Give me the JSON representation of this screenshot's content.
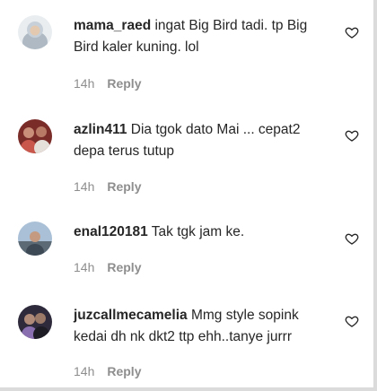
{
  "comments": [
    {
      "username": "mama_raed",
      "text": "ingat Big Bird tadi. tp Big Bird kaler kuning. lol",
      "time": "14h",
      "reply_label": "Reply",
      "avatar_icon": "user-avatar-hijab",
      "avatar_colors": [
        "#e8ecef",
        "#b9c3cc"
      ]
    },
    {
      "username": "azlin411",
      "text": "Dia tgok dato Mai ... cepat2 depa terus tutup",
      "time": "14h",
      "reply_label": "Reply",
      "avatar_icon": "user-avatar-group",
      "avatar_colors": [
        "#7b2d2a",
        "#c9574c"
      ]
    },
    {
      "username": "enal120181",
      "text": "Tak tgk jam ke.",
      "time": "14h",
      "reply_label": "Reply",
      "avatar_icon": "user-avatar-outdoor",
      "avatar_colors": [
        "#9fb7cf",
        "#4a5866"
      ]
    },
    {
      "username": "juzcallmecamelia",
      "text": "Mmg style sopink kedai dh nk dkt2 ttp ehh..tanye jurrr",
      "time": "14h",
      "reply_label": "Reply",
      "avatar_icon": "user-avatar-couple",
      "avatar_colors": [
        "#2f2b3c",
        "#8a6fb0"
      ]
    }
  ],
  "like_icon": "heart-outline-icon"
}
